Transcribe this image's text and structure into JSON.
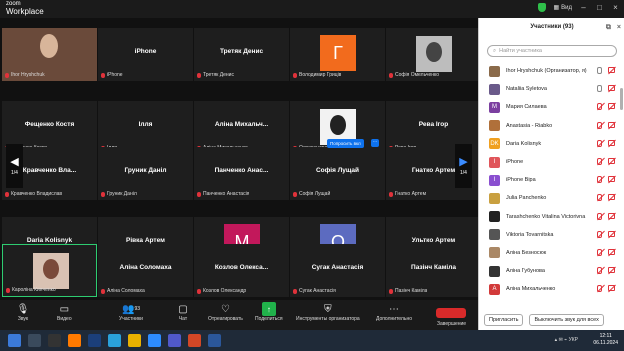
{
  "app": {
    "brand_top": "zoom",
    "brand_bottom": "Workplace",
    "view_label": "Вид"
  },
  "grid": {
    "page_left": "1/4",
    "page_right": "1/4",
    "raise_hand": "Попросить вкл",
    "tiles": [
      {
        "name": "",
        "label": "Ihor Hryshchuk",
        "avatar": ""
      },
      {
        "name": "iPhone",
        "label": "iPhone",
        "avatar": ""
      },
      {
        "name": "Третяк Денис",
        "label": "Третяк Денис",
        "avatar": ""
      },
      {
        "name": "",
        "label": "Володимир Гриців",
        "avatar": "Г"
      },
      {
        "name": "",
        "label": "Софія Омельченко",
        "avatar": ""
      },
      {
        "name": "Фещенко Костя",
        "label": "Фещенко Костя",
        "avatar": ""
      },
      {
        "name": "Ілля",
        "label": "Ілля",
        "avatar": ""
      },
      {
        "name": "Аліна Михальч...",
        "label": "Аліна Михальченко",
        "avatar": ""
      },
      {
        "name": "",
        "label": "Олександра Гарбуза",
        "avatar": ""
      },
      {
        "name": "Рева Ігор",
        "label": "Рева Ігор",
        "avatar": ""
      },
      {
        "name": "Кравченко Вла...",
        "label": "Кравченко Владислав",
        "avatar": ""
      },
      {
        "name": "Груник Даніл",
        "label": "Груник Даніл",
        "avatar": ""
      },
      {
        "name": "Панченко Анас...",
        "label": "Панченко Анастасія",
        "avatar": ""
      },
      {
        "name": "Софія Лущай",
        "label": "Софія Лущай",
        "avatar": ""
      },
      {
        "name": "Гнатко Артем",
        "label": "Гнатко Артем",
        "avatar": ""
      },
      {
        "name": "Daria Kolisnyk",
        "label": "Daria Kolisnyk",
        "avatar": ""
      },
      {
        "name": "Рівка Артем",
        "label": "Рівка Артем",
        "avatar": ""
      },
      {
        "name": "",
        "label": "Марія Ізей",
        "avatar": "M"
      },
      {
        "name": "",
        "label": "Олена Больбот",
        "avatar": "O"
      },
      {
        "name": "Ультко Артем",
        "label": "Ультко Артем",
        "avatar": ""
      },
      {
        "name": "",
        "label": "Кароліна Кияченко",
        "avatar": ""
      },
      {
        "name": "Аліна Соломаха",
        "label": "Аліна Соломаха",
        "avatar": ""
      },
      {
        "name": "Козлов Олекса...",
        "label": "Козлов Олександр",
        "avatar": ""
      },
      {
        "name": "Сугак Анастасія",
        "label": "Сугак Анастасія",
        "avatar": ""
      },
      {
        "name": "Пазінч Каміла",
        "label": "Пазінч Каміла",
        "avatar": ""
      }
    ]
  },
  "panel": {
    "title": "Участники (93)",
    "search_placeholder": "Найти участника",
    "participants": [
      {
        "name": "Ihor Hryshchuk (Организатор, я)",
        "initial": "",
        "color": "#8a6a4a",
        "mic_on": true
      },
      {
        "name": "Nataliia Syletova",
        "initial": "",
        "color": "#6a5a8a",
        "mic_on": true
      },
      {
        "name": "Мария Силаева",
        "initial": "M",
        "color": "#7b3fa0",
        "mic_on": false
      },
      {
        "name": "Anastasia - Riabko",
        "initial": "",
        "color": "#b0703a",
        "mic_on": false
      },
      {
        "name": "Daria Kolisnyk",
        "initial": "DK",
        "color": "#f0a020",
        "mic_on": false
      },
      {
        "name": "iPhone",
        "initial": "I",
        "color": "#e0555a",
        "mic_on": false
      },
      {
        "name": "iPhone Віра",
        "initial": "I",
        "color": "#8a4fd0",
        "mic_on": false
      },
      {
        "name": "Julia Panchenko",
        "initial": "",
        "color": "#c9a040",
        "mic_on": false
      },
      {
        "name": "Tarashchenko Vitalina Victorivna",
        "initial": "",
        "color": "#222222",
        "mic_on": false
      },
      {
        "name": "Viktoria Tovarnitska",
        "initial": "",
        "color": "#555555",
        "mic_on": false
      },
      {
        "name": "Аліна Безносюк",
        "initial": "",
        "color": "#aa8866",
        "mic_on": false
      },
      {
        "name": "Аліна Губунова",
        "initial": "",
        "color": "#333333",
        "mic_on": false
      },
      {
        "name": "Аліна Михальченко",
        "initial": "A",
        "color": "#d23a3a",
        "mic_on": false
      }
    ],
    "invite": "Пригласить",
    "mute_all": "Выключить звук для всех"
  },
  "toolbar": {
    "audio": "Звук",
    "video": "Видео",
    "participants": "Участники",
    "participants_count": "93",
    "chat": "Чат",
    "react": "Отреагировать",
    "share": "Поделиться",
    "host_tools": "Инструменты организатора",
    "more": "Дополнительно",
    "end": "Завершение"
  },
  "taskbar": {
    "lang": "УКР",
    "time": "12:11",
    "date": "06.11.2024"
  }
}
